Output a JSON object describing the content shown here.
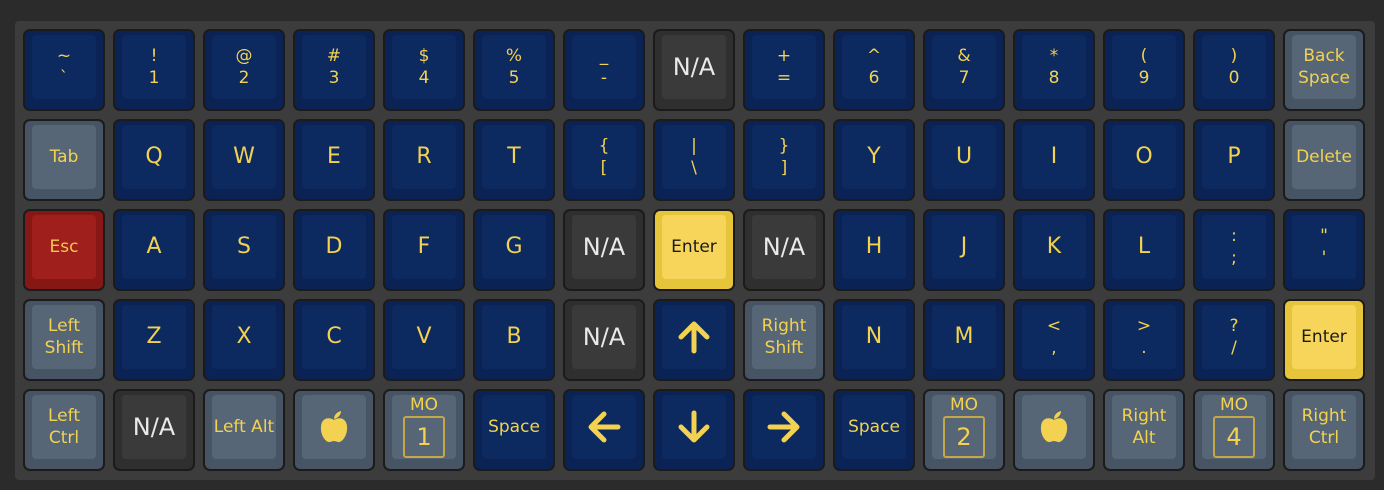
{
  "colors": {
    "accent_yellow": "#f2d250",
    "key_blue": "#0c2a60",
    "key_gray": "#566677",
    "key_dark": "#3a3a3a",
    "key_red": "#9e1f1b",
    "key_yellow": "#f6d55a"
  },
  "rows": [
    [
      {
        "type": "dual",
        "top": "~",
        "bottom": "`",
        "style": "blue"
      },
      {
        "type": "dual",
        "top": "!",
        "bottom": "1",
        "style": "blue"
      },
      {
        "type": "dual",
        "top": "@",
        "bottom": "2",
        "style": "blue"
      },
      {
        "type": "dual",
        "top": "#",
        "bottom": "3",
        "style": "blue"
      },
      {
        "type": "dual",
        "top": "$",
        "bottom": "4",
        "style": "blue"
      },
      {
        "type": "dual",
        "top": "%",
        "bottom": "5",
        "style": "blue"
      },
      {
        "type": "dual",
        "top": "_",
        "bottom": "-",
        "style": "blue"
      },
      {
        "type": "na",
        "label": "N/A",
        "style": "dark"
      },
      {
        "type": "dual",
        "top": "+",
        "bottom": "=",
        "style": "blue"
      },
      {
        "type": "dual",
        "top": "^",
        "bottom": "6",
        "style": "blue"
      },
      {
        "type": "dual",
        "top": "&",
        "bottom": "7",
        "style": "blue"
      },
      {
        "type": "dual",
        "top": "*",
        "bottom": "8",
        "style": "blue"
      },
      {
        "type": "dual",
        "top": "(",
        "bottom": "9",
        "style": "blue"
      },
      {
        "type": "dual",
        "top": ")",
        "bottom": "0",
        "style": "blue"
      },
      {
        "type": "small",
        "label": "Back\nSpace",
        "style": "gray"
      }
    ],
    [
      {
        "type": "small",
        "label": "Tab",
        "style": "gray"
      },
      {
        "type": "letter",
        "label": "Q",
        "style": "blue"
      },
      {
        "type": "letter",
        "label": "W",
        "style": "blue"
      },
      {
        "type": "letter",
        "label": "E",
        "style": "blue"
      },
      {
        "type": "letter",
        "label": "R",
        "style": "blue"
      },
      {
        "type": "letter",
        "label": "T",
        "style": "blue"
      },
      {
        "type": "dual",
        "top": "{",
        "bottom": "[",
        "style": "blue"
      },
      {
        "type": "dual",
        "top": "|",
        "bottom": "\\",
        "style": "blue"
      },
      {
        "type": "dual",
        "top": "}",
        "bottom": "]",
        "style": "blue"
      },
      {
        "type": "letter",
        "label": "Y",
        "style": "blue"
      },
      {
        "type": "letter",
        "label": "U",
        "style": "blue"
      },
      {
        "type": "letter",
        "label": "I",
        "style": "blue"
      },
      {
        "type": "letter",
        "label": "O",
        "style": "blue"
      },
      {
        "type": "letter",
        "label": "P",
        "style": "blue"
      },
      {
        "type": "small",
        "label": "Delete",
        "style": "gray"
      }
    ],
    [
      {
        "type": "small",
        "label": "Esc",
        "style": "red"
      },
      {
        "type": "letter",
        "label": "A",
        "style": "blue"
      },
      {
        "type": "letter",
        "label": "S",
        "style": "blue"
      },
      {
        "type": "letter",
        "label": "D",
        "style": "blue"
      },
      {
        "type": "letter",
        "label": "F",
        "style": "blue"
      },
      {
        "type": "letter",
        "label": "G",
        "style": "blue"
      },
      {
        "type": "na",
        "label": "N/A",
        "style": "dark"
      },
      {
        "type": "small",
        "label": "Enter",
        "style": "yellow"
      },
      {
        "type": "na",
        "label": "N/A",
        "style": "dark"
      },
      {
        "type": "letter",
        "label": "H",
        "style": "blue"
      },
      {
        "type": "letter",
        "label": "J",
        "style": "blue"
      },
      {
        "type": "letter",
        "label": "K",
        "style": "blue"
      },
      {
        "type": "letter",
        "label": "L",
        "style": "blue"
      },
      {
        "type": "dual",
        "top": ":",
        "bottom": ";",
        "style": "blue"
      },
      {
        "type": "dual",
        "top": "\"",
        "bottom": "'",
        "style": "blue"
      }
    ],
    [
      {
        "type": "small",
        "label": "Left\nShift",
        "style": "gray"
      },
      {
        "type": "letter",
        "label": "Z",
        "style": "blue"
      },
      {
        "type": "letter",
        "label": "X",
        "style": "blue"
      },
      {
        "type": "letter",
        "label": "C",
        "style": "blue"
      },
      {
        "type": "letter",
        "label": "V",
        "style": "blue"
      },
      {
        "type": "letter",
        "label": "B",
        "style": "blue"
      },
      {
        "type": "na",
        "label": "N/A",
        "style": "dark"
      },
      {
        "type": "icon",
        "icon": "arrow-up-icon",
        "style": "blue"
      },
      {
        "type": "small",
        "label": "Right\nShift",
        "style": "gray"
      },
      {
        "type": "letter",
        "label": "N",
        "style": "blue"
      },
      {
        "type": "letter",
        "label": "M",
        "style": "blue"
      },
      {
        "type": "dual",
        "top": "<",
        "bottom": ",",
        "style": "blue"
      },
      {
        "type": "dual",
        "top": ">",
        "bottom": ".",
        "style": "blue"
      },
      {
        "type": "dual",
        "top": "?",
        "bottom": "/",
        "style": "blue"
      },
      {
        "type": "small",
        "label": "Enter",
        "style": "yellow"
      }
    ],
    [
      {
        "type": "small",
        "label": "Left\nCtrl",
        "style": "gray"
      },
      {
        "type": "na",
        "label": "N/A",
        "style": "dark"
      },
      {
        "type": "small",
        "label": "Left Alt",
        "style": "gray"
      },
      {
        "type": "icon",
        "icon": "apple-icon",
        "style": "gray"
      },
      {
        "type": "mo",
        "top": "MO",
        "layer": "1",
        "style": "gray"
      },
      {
        "type": "small",
        "label": "Space",
        "style": "blue"
      },
      {
        "type": "icon",
        "icon": "arrow-left-icon",
        "style": "blue"
      },
      {
        "type": "icon",
        "icon": "arrow-down-icon",
        "style": "blue"
      },
      {
        "type": "icon",
        "icon": "arrow-right-icon",
        "style": "blue"
      },
      {
        "type": "small",
        "label": "Space",
        "style": "blue"
      },
      {
        "type": "mo",
        "top": "MO",
        "layer": "2",
        "style": "gray"
      },
      {
        "type": "icon",
        "icon": "apple-icon",
        "style": "gray"
      },
      {
        "type": "small",
        "label": "Right\nAlt",
        "style": "gray"
      },
      {
        "type": "mo",
        "top": "MO",
        "layer": "4",
        "style": "gray"
      },
      {
        "type": "small",
        "label": "Right\nCtrl",
        "style": "gray"
      }
    ]
  ]
}
